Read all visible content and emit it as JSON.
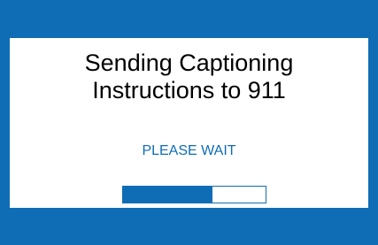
{
  "dialog": {
    "title_line1": "Sending Captioning",
    "title_line2": "Instructions to 911",
    "status": "PLEASE WAIT",
    "progress_fraction": 0.63
  },
  "colors": {
    "accent": "#0f6db5",
    "panel": "#ffffff",
    "text": "#000000"
  }
}
